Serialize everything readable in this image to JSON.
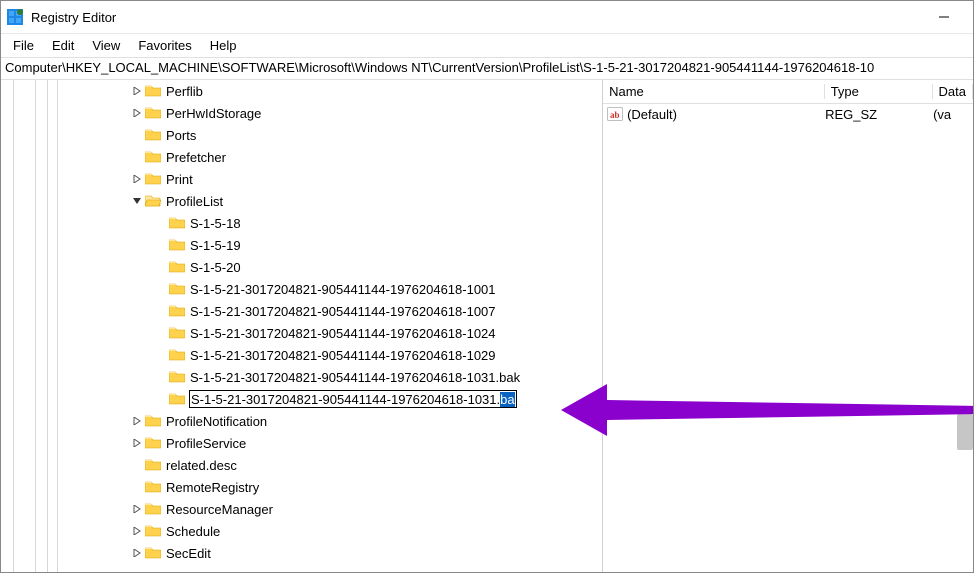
{
  "window": {
    "title": "Registry Editor"
  },
  "menu": {
    "file": "File",
    "edit": "Edit",
    "view": "View",
    "favorites": "Favorites",
    "help": "Help"
  },
  "path": "Computer\\HKEY_LOCAL_MACHINE\\SOFTWARE\\Microsoft\\Windows NT\\CurrentVersion\\ProfileList\\S-1-5-21-3017204821-905441144-1976204618-10",
  "tree": {
    "nodes": [
      {
        "indent": 128,
        "expander": ">",
        "label": "Perflib"
      },
      {
        "indent": 128,
        "expander": ">",
        "label": "PerHwIdStorage"
      },
      {
        "indent": 128,
        "expander": "",
        "label": "Ports"
      },
      {
        "indent": 128,
        "expander": "",
        "label": "Prefetcher"
      },
      {
        "indent": 128,
        "expander": ">",
        "label": "Print"
      },
      {
        "indent": 128,
        "expander": "v",
        "label": "ProfileList",
        "open": true
      },
      {
        "indent": 152,
        "expander": "",
        "label": "S-1-5-18"
      },
      {
        "indent": 152,
        "expander": "",
        "label": "S-1-5-19"
      },
      {
        "indent": 152,
        "expander": "",
        "label": "S-1-5-20"
      },
      {
        "indent": 152,
        "expander": "",
        "label": "S-1-5-21-3017204821-905441144-1976204618-1001"
      },
      {
        "indent": 152,
        "expander": "",
        "label": "S-1-5-21-3017204821-905441144-1976204618-1007"
      },
      {
        "indent": 152,
        "expander": "",
        "label": "S-1-5-21-3017204821-905441144-1976204618-1024"
      },
      {
        "indent": 152,
        "expander": "",
        "label": "S-1-5-21-3017204821-905441144-1976204618-1029"
      },
      {
        "indent": 152,
        "expander": "",
        "label": "S-1-5-21-3017204821-905441144-1976204618-1031.bak"
      },
      {
        "indent": 152,
        "expander": "",
        "editing": true,
        "edit_plain": "S-1-5-21-3017204821-905441144-1976204618-1031.",
        "edit_sel": "ba"
      },
      {
        "indent": 128,
        "expander": ">",
        "label": "ProfileNotification"
      },
      {
        "indent": 128,
        "expander": ">",
        "label": "ProfileService"
      },
      {
        "indent": 128,
        "expander": "",
        "label": "related.desc"
      },
      {
        "indent": 128,
        "expander": "",
        "label": "RemoteRegistry"
      },
      {
        "indent": 128,
        "expander": ">",
        "label": "ResourceManager"
      },
      {
        "indent": 128,
        "expander": ">",
        "label": "Schedule"
      },
      {
        "indent": 128,
        "expander": ">",
        "label": "SecEdit"
      }
    ]
  },
  "right": {
    "cols": {
      "name": "Name",
      "type": "Type",
      "data": "Data"
    },
    "rows": [
      {
        "name": "(Default)",
        "type": "REG_SZ",
        "data": "(va"
      }
    ]
  }
}
